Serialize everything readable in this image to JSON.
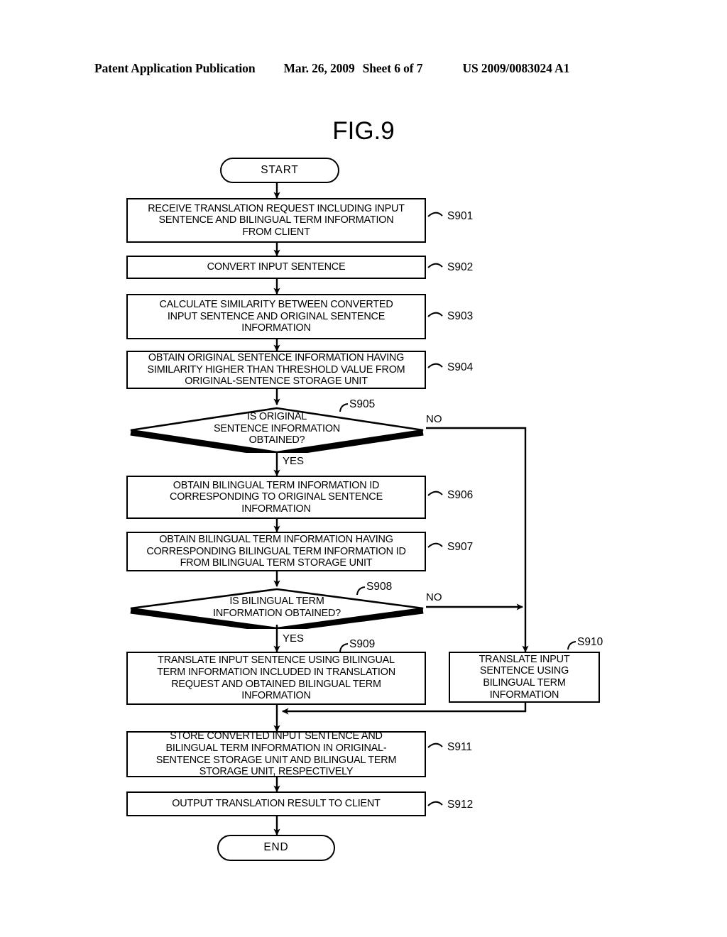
{
  "header": {
    "publication": "Patent Application Publication",
    "date": "Mar. 26, 2009",
    "sheet": "Sheet 6 of 7",
    "number": "US 2009/0083024 A1"
  },
  "figure": {
    "title": "FIG.9"
  },
  "chart_data": {
    "type": "diagram",
    "diagram_type": "flowchart",
    "title": "FIG.9",
    "orientation": "top-to-bottom",
    "nodes": [
      {
        "id": "start",
        "shape": "terminator",
        "label": "START",
        "step": ""
      },
      {
        "id": "s901",
        "shape": "process",
        "label": "RECEIVE TRANSLATION REQUEST INCLUDING INPUT SENTENCE AND BILINGUAL TERM INFORMATION FROM CLIENT",
        "step": "S901"
      },
      {
        "id": "s902",
        "shape": "process",
        "label": "CONVERT INPUT SENTENCE",
        "step": "S902"
      },
      {
        "id": "s903",
        "shape": "process",
        "label": "CALCULATE SIMILARITY BETWEEN CONVERTED INPUT SENTENCE AND ORIGINAL SENTENCE INFORMATION",
        "step": "S903"
      },
      {
        "id": "s904",
        "shape": "process",
        "label": "OBTAIN ORIGINAL SENTENCE INFORMATION HAVING SIMILARITY HIGHER THAN THRESHOLD VALUE FROM ORIGINAL-SENTENCE STORAGE UNIT",
        "step": "S904"
      },
      {
        "id": "s905",
        "shape": "decision",
        "label": "IS ORIGINAL SENTENCE INFORMATION OBTAINED?",
        "step": "S905"
      },
      {
        "id": "s906",
        "shape": "process",
        "label": "OBTAIN BILINGUAL TERM INFORMATION ID CORRESPONDING TO ORIGINAL SENTENCE INFORMATION",
        "step": "S906"
      },
      {
        "id": "s907",
        "shape": "process",
        "label": "OBTAIN BILINGUAL TERM INFORMATION HAVING CORRESPONDING BILINGUAL TERM INFORMATION ID FROM BILINGUAL TERM STORAGE UNIT",
        "step": "S907"
      },
      {
        "id": "s908",
        "shape": "decision",
        "label": "IS BILINGUAL TERM INFORMATION OBTAINED?",
        "step": "S908"
      },
      {
        "id": "s909",
        "shape": "process",
        "label": "TRANSLATE INPUT SENTENCE USING BILINGUAL TERM INFORMATION INCLUDED IN TRANSLATION REQUEST AND OBTAINED BILINGUAL TERM INFORMATION",
        "step": "S909"
      },
      {
        "id": "s910",
        "shape": "process",
        "label": "TRANSLATE INPUT SENTENCE USING BILINGUAL TERM INFORMATION",
        "step": "S910"
      },
      {
        "id": "s911",
        "shape": "process",
        "label": "STORE CONVERTED INPUT SENTENCE AND BILINGUAL TERM INFORMATION IN ORIGINAL-SENTENCE STORAGE UNIT AND BILINGUAL TERM STORAGE UNIT, RESPECTIVELY",
        "step": "S911"
      },
      {
        "id": "s912",
        "shape": "process",
        "label": "OUTPUT TRANSLATION RESULT TO CLIENT",
        "step": "S912"
      },
      {
        "id": "end",
        "shape": "terminator",
        "label": "END",
        "step": ""
      }
    ],
    "edges": [
      {
        "from": "start",
        "to": "s901",
        "label": ""
      },
      {
        "from": "s901",
        "to": "s902",
        "label": ""
      },
      {
        "from": "s902",
        "to": "s903",
        "label": ""
      },
      {
        "from": "s903",
        "to": "s904",
        "label": ""
      },
      {
        "from": "s904",
        "to": "s905",
        "label": ""
      },
      {
        "from": "s905",
        "to": "s906",
        "label": "YES"
      },
      {
        "from": "s905",
        "to": "s910",
        "label": "NO"
      },
      {
        "from": "s906",
        "to": "s907",
        "label": ""
      },
      {
        "from": "s907",
        "to": "s908",
        "label": ""
      },
      {
        "from": "s908",
        "to": "s909",
        "label": "YES"
      },
      {
        "from": "s908",
        "to": "s910",
        "label": "NO"
      },
      {
        "from": "s909",
        "to": "s911",
        "label": ""
      },
      {
        "from": "s910",
        "to": "s911",
        "label": ""
      },
      {
        "from": "s911",
        "to": "s912",
        "label": ""
      },
      {
        "from": "s912",
        "to": "end",
        "label": ""
      }
    ]
  },
  "nodes": {
    "start": {
      "label": "START"
    },
    "s901": {
      "l1": "RECEIVE TRANSLATION REQUEST INCLUDING INPUT",
      "l2": "SENTENCE AND BILINGUAL TERM INFORMATION",
      "l3": "FROM CLIENT",
      "step": "S901"
    },
    "s902": {
      "l1": "CONVERT INPUT SENTENCE",
      "step": "S902"
    },
    "s903": {
      "l1": "CALCULATE SIMILARITY BETWEEN CONVERTED",
      "l2": "INPUT SENTENCE AND ORIGINAL SENTENCE",
      "l3": "INFORMATION",
      "step": "S903"
    },
    "s904": {
      "l1": "OBTAIN ORIGINAL SENTENCE INFORMATION HAVING",
      "l2": "SIMILARITY HIGHER THAN THRESHOLD VALUE FROM",
      "l3": "ORIGINAL-SENTENCE STORAGE UNIT",
      "step": "S904"
    },
    "s905": {
      "l1": "IS ORIGINAL",
      "l2": "SENTENCE INFORMATION",
      "l3": "OBTAINED?",
      "step": "S905",
      "yes": "YES",
      "no": "NO"
    },
    "s906": {
      "l1": "OBTAIN BILINGUAL TERM INFORMATION ID",
      "l2": "CORRESPONDING TO ORIGINAL SENTENCE",
      "l3": "INFORMATION",
      "step": "S906"
    },
    "s907": {
      "l1": "OBTAIN BILINGUAL TERM INFORMATION HAVING",
      "l2": "CORRESPONDING BILINGUAL TERM INFORMATION ID",
      "l3": "FROM BILINGUAL TERM STORAGE UNIT",
      "step": "S907"
    },
    "s908": {
      "l1": "IS BILINGUAL TERM",
      "l2": "INFORMATION OBTAINED?",
      "step": "S908",
      "yes": "YES",
      "no": "NO"
    },
    "s909": {
      "l1": "TRANSLATE INPUT SENTENCE USING BILINGUAL",
      "l2": "TERM INFORMATION INCLUDED IN TRANSLATION",
      "l3": "REQUEST AND OBTAINED BILINGUAL TERM",
      "l4": "INFORMATION",
      "step": "S909"
    },
    "s910": {
      "l1": "TRANSLATE INPUT",
      "l2": "SENTENCE USING",
      "l3": "BILINGUAL TERM",
      "l4": "INFORMATION",
      "step": "S910"
    },
    "s911": {
      "l1": "STORE CONVERTED INPUT SENTENCE AND",
      "l2": "BILINGUAL TERM INFORMATION IN ORIGINAL-",
      "l3": "SENTENCE STORAGE UNIT AND BILINGUAL TERM",
      "l4": "STORAGE UNIT, RESPECTIVELY",
      "step": "S911"
    },
    "s912": {
      "l1": "OUTPUT TRANSLATION RESULT TO CLIENT",
      "step": "S912"
    },
    "end": {
      "label": "END"
    }
  },
  "colors": {
    "ink": "#000000",
    "paper": "#ffffff"
  }
}
